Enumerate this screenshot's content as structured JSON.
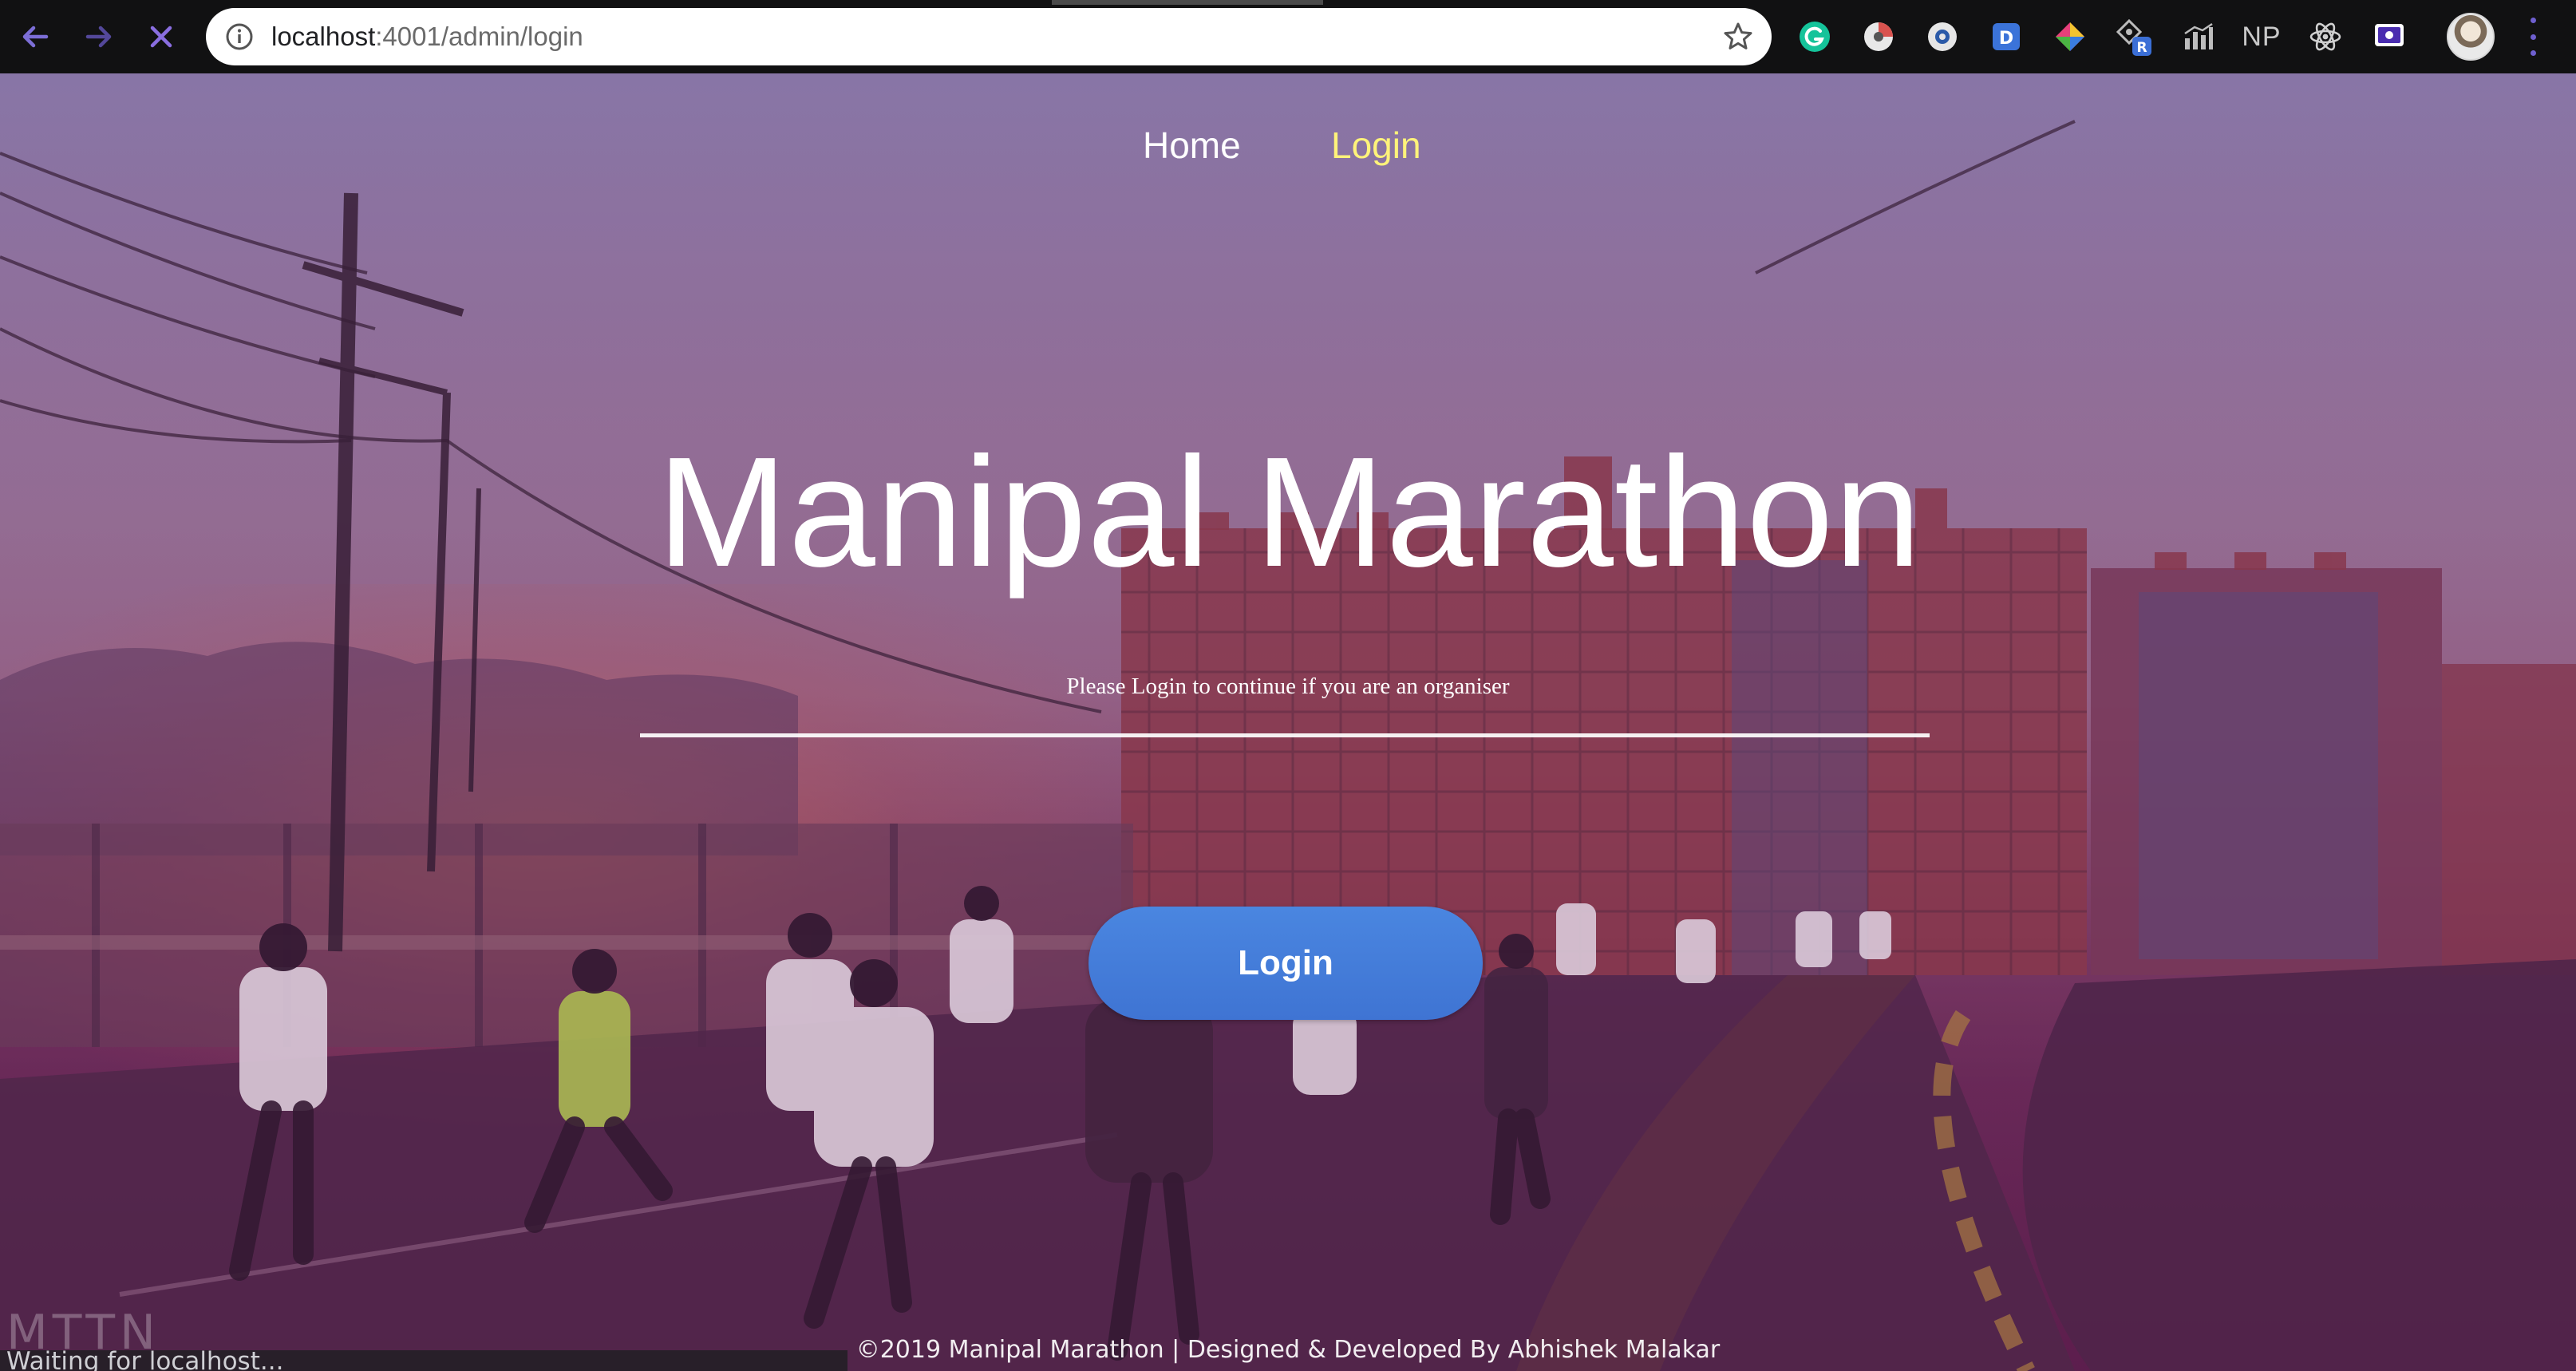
{
  "browser": {
    "url_host": "localhost",
    "url_path": ":4001/admin/login",
    "extensions": [
      "grammarly-icon",
      "pie-extension-icon",
      "circle-extension-icon",
      "dictionary-extension-icon",
      "color-extension-icon",
      "react-r-extension-icon",
      "chart-extension-icon",
      "np-extension-icon",
      "react-devtools-icon",
      "screen-extension-icon"
    ],
    "extension_np_label": "NP",
    "colors": {
      "nav_arrows": "#7c6ed6",
      "stop": "#8a6ee0"
    }
  },
  "nav": {
    "home": "Home",
    "login": "Login",
    "active_color": "#fff37a"
  },
  "hero": {
    "title": "Manipal Marathon",
    "subtitle": "Please Login to continue if you are an organiser",
    "button_label": "Login",
    "button_color": "#4380da"
  },
  "footer": {
    "text": "©2019 Manipal Marathon | Designed & Developed By Abhishek Malakar"
  },
  "status": {
    "text": "Waiting for localhost..."
  },
  "watermark": {
    "text": "MTTN"
  }
}
